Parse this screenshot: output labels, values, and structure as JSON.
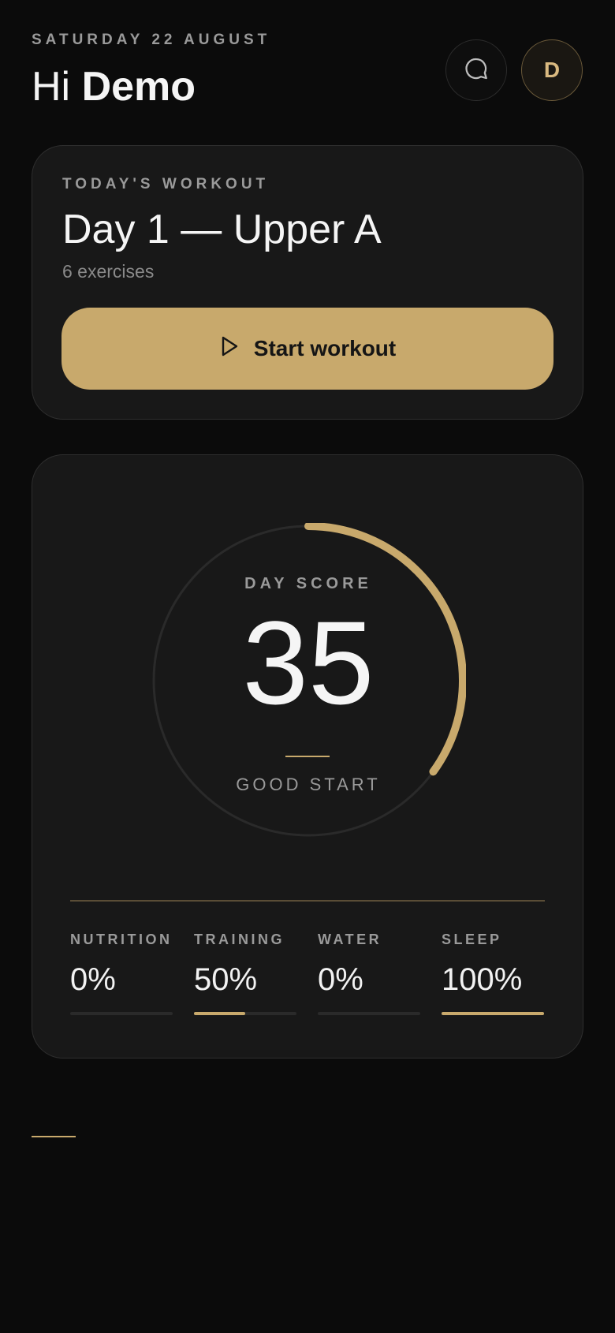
{
  "header": {
    "date": "SATURDAY 22 AUGUST",
    "greeting_prefix": "Hi",
    "user_name": "Demo",
    "chat_icon": "chat-bubble-icon",
    "avatar_initial": "D"
  },
  "workout": {
    "eyebrow": "TODAY'S WORKOUT",
    "title": "Day 1 — Upper A",
    "subtitle": "6 exercises",
    "start_label": "Start workout",
    "start_icon": "play-icon"
  },
  "score": {
    "eyebrow": "DAY SCORE",
    "value": "35",
    "status": "GOOD START",
    "progress": 0.35
  },
  "metrics": [
    {
      "label": "NUTRITION",
      "value": "0%",
      "progress": 0
    },
    {
      "label": "TRAINING",
      "value": "50%",
      "progress": 0.5
    },
    {
      "label": "WATER",
      "value": "0%",
      "progress": 0
    },
    {
      "label": "SLEEP",
      "value": "100%",
      "progress": 1
    }
  ],
  "colors": {
    "accent": "#c8a96c",
    "background": "#0b0b0b",
    "card": "#181818"
  }
}
